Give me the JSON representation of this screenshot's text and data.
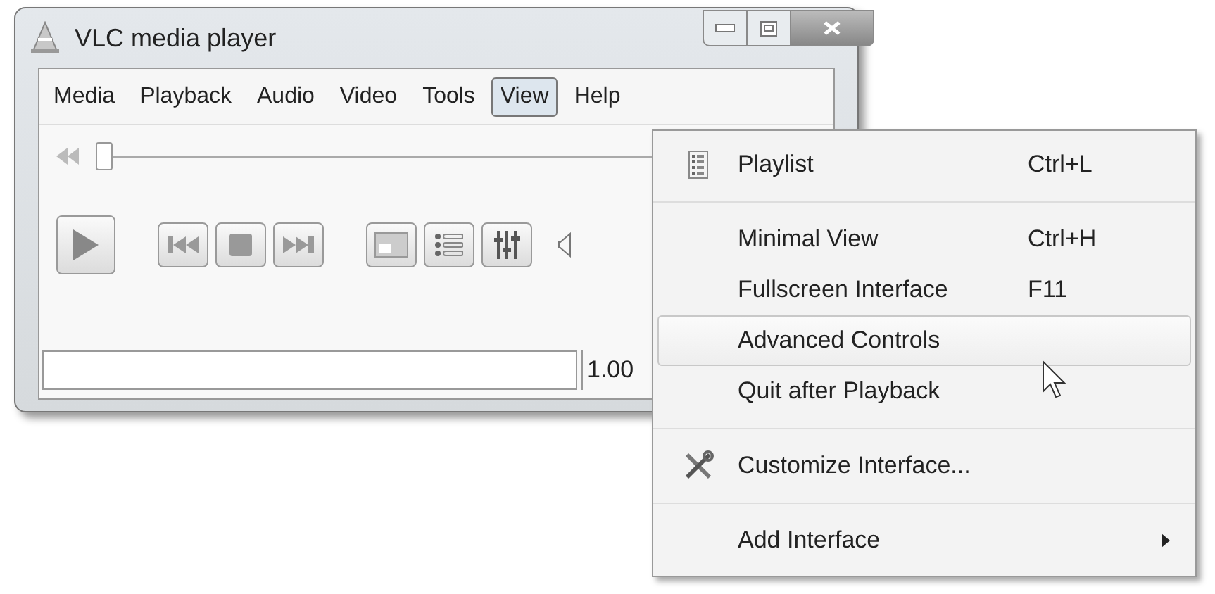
{
  "window": {
    "title": "VLC media player"
  },
  "menu_bar": [
    {
      "label": "Media",
      "selected": false
    },
    {
      "label": "Playback",
      "selected": false
    },
    {
      "label": "Audio",
      "selected": false
    },
    {
      "label": "Video",
      "selected": false
    },
    {
      "label": "Tools",
      "selected": false
    },
    {
      "label": "View",
      "selected": true
    },
    {
      "label": "Help",
      "selected": false
    }
  ],
  "seek": {
    "level": 0
  },
  "speed": "1.00",
  "view_menu": {
    "groups": [
      {
        "items": [
          {
            "kind": "item",
            "label": "Playlist",
            "shortcut": "Ctrl+L",
            "selected": false
          }
        ]
      },
      {
        "items": [
          {
            "kind": "item",
            "label": "Minimal View",
            "shortcut": "Ctrl+H",
            "selected": false
          },
          {
            "kind": "item",
            "label": "Fullscreen Interface",
            "shortcut": "F11",
            "selected": false
          },
          {
            "kind": "item",
            "label": "Advanced Controls",
            "selected": true
          },
          {
            "kind": "item",
            "label": "Quit after Playback",
            "selected": false
          }
        ]
      },
      {
        "items": [
          {
            "kind": "item",
            "label": "Customize Interface...",
            "selected": false
          }
        ]
      },
      {
        "items": [
          {
            "kind": "submenu",
            "label": "Add Interface",
            "selected": false
          }
        ]
      }
    ]
  }
}
